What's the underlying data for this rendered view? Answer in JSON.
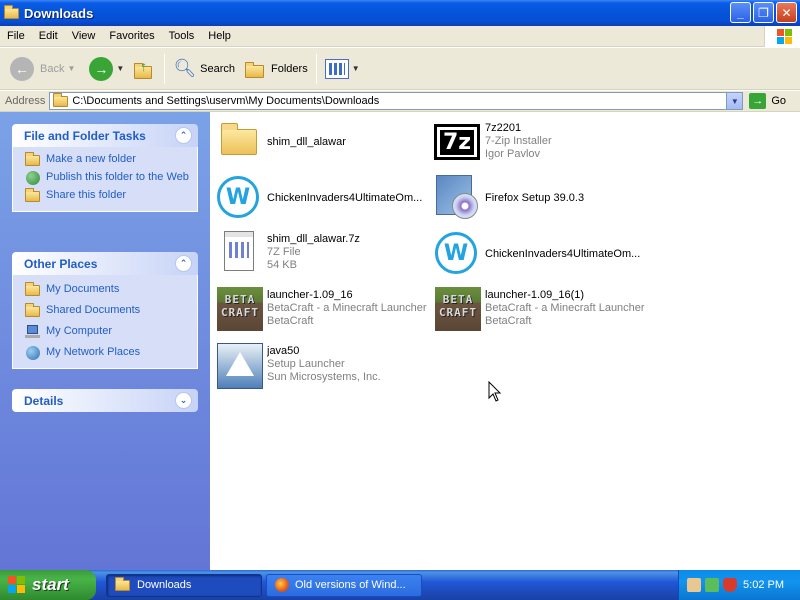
{
  "window": {
    "title": "Downloads"
  },
  "menu": [
    "File",
    "Edit",
    "View",
    "Favorites",
    "Tools",
    "Help"
  ],
  "toolbar": {
    "back": "Back",
    "search": "Search",
    "folders": "Folders"
  },
  "address": {
    "label": "Address",
    "path": "C:\\Documents and Settings\\uservm\\My Documents\\Downloads",
    "go": "Go"
  },
  "left": {
    "tasks": {
      "title": "File and Folder Tasks",
      "items": [
        "Make a new folder",
        "Publish this folder to the Web",
        "Share this folder"
      ]
    },
    "places": {
      "title": "Other Places",
      "items": [
        "My Documents",
        "Shared Documents",
        "My Computer",
        "My Network Places"
      ]
    },
    "details": {
      "title": "Details"
    }
  },
  "files": [
    {
      "name": "shim_dll_alawar",
      "lines": []
    },
    {
      "name": "7z2201",
      "lines": [
        "7-Zip Installer",
        "Igor Pavlov"
      ]
    },
    {
      "name": "ChickenInvaders4UltimateOm...",
      "lines": []
    },
    {
      "name": "Firefox Setup 39.0.3",
      "lines": []
    },
    {
      "name": "shim_dll_alawar.7z",
      "lines": [
        "7Z File",
        "54 KB"
      ]
    },
    {
      "name": "ChickenInvaders4UltimateOm...",
      "lines": []
    },
    {
      "name": "launcher-1.09_16",
      "lines": [
        "BetaCraft - a Minecraft Launcher",
        "BetaCraft"
      ]
    },
    {
      "name": "launcher-1.09_16(1)",
      "lines": [
        "BetaCraft - a Minecraft Launcher",
        "BetaCraft"
      ]
    },
    {
      "name": "java50",
      "lines": [
        "Setup Launcher",
        "Sun Microsystems, Inc."
      ]
    }
  ],
  "icons": {
    "beta_text": "BETA CRAFT",
    "sevenz_text": "7z",
    "chicken_text": "W"
  },
  "taskbar": {
    "start": "start",
    "buttons": [
      "Downloads",
      "Old versions of Wind..."
    ],
    "clock": "5:02 PM"
  }
}
